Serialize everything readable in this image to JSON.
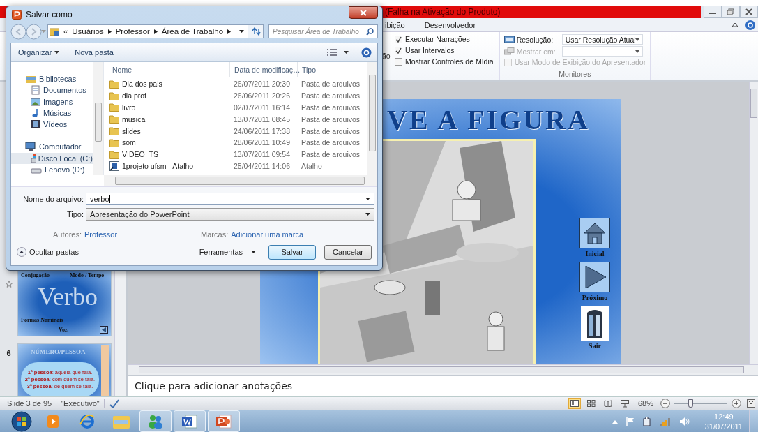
{
  "powerpoint": {
    "title": "(Falha na Ativação do Produto)",
    "tabs": [
      {
        "label": "ibição",
        "selected": false
      },
      {
        "label": "Desenvolvedor",
        "selected": false
      }
    ],
    "ribbon": {
      "cut_label": "ão",
      "options": [
        {
          "label": "Executar Narrações",
          "checked": true,
          "disabled": false
        },
        {
          "label": "Usar Intervalos",
          "checked": true,
          "disabled": false
        },
        {
          "label": "Mostrar Controles de Mídia",
          "checked": false,
          "disabled": false
        }
      ],
      "monitors": {
        "resolution_label": "Resolução:",
        "resolution_value": "Usar Resolução Atual",
        "show_on_label": "Mostrar em:",
        "presenter": {
          "label": "Usar Modo de Exibição do Apresentador",
          "checked": false,
          "disabled": true
        },
        "label": "Monitores"
      }
    },
    "slides": [
      {
        "animated": true,
        "selected": false,
        "kind": "verbo",
        "top_labels": [
          "Conjugação",
          "Modo / Tempo"
        ],
        "title": "Verbo",
        "bottom_labels": [
          "Formas Nominais",
          "Voz"
        ]
      },
      {
        "number": "6",
        "animated": false,
        "selected": false,
        "kind": "pessoa",
        "title": "NÚMERO/PESSOA",
        "lines": [
          "**1ª pessoa**: aquela que fala.",
          "**2ª pessoa**: com quem se fala.",
          "**3ª pessoa**: de quem se fala."
        ]
      }
    ],
    "slide": {
      "title": "VE A FIGURA",
      "nav": [
        {
          "label": "Inicial",
          "kind": "home"
        },
        {
          "label": "Próximo",
          "kind": "next"
        },
        {
          "label": "Sair",
          "kind": "exit"
        }
      ]
    },
    "notes_placeholder": "Clique para adicionar anotações",
    "status": {
      "slide_info": "Slide 3 de 95",
      "theme": "\"Executivo\"",
      "views": [
        {
          "kind": "normal",
          "selected": true
        },
        {
          "kind": "sorter",
          "selected": false
        },
        {
          "kind": "reading",
          "selected": false
        },
        {
          "kind": "slideshow",
          "selected": false
        }
      ],
      "zoom": "68%",
      "zoom_slider": {
        "level": 0.3
      }
    }
  },
  "dialog": {
    "title": "Salvar como",
    "breadcrumb_prefix": "«",
    "breadcrumb": [
      "Usuários",
      "Professor",
      "Área de Trabalho"
    ],
    "search": {
      "placeholder": "Pesquisar Área de Trabalho"
    },
    "toolbar": [
      {
        "label": "Organizar",
        "kind": "menu"
      },
      {
        "label": "Nova pasta",
        "kind": "button"
      }
    ],
    "nav": [
      {
        "label": "Bibliotecas",
        "kind": "library",
        "selected": false,
        "children": [
          {
            "label": "Documentos",
            "kind": "documents",
            "selected": false
          },
          {
            "label": "Imagens",
            "kind": "images",
            "selected": false
          },
          {
            "label": "Músicas",
            "kind": "music",
            "selected": false
          },
          {
            "label": "Vídeos",
            "kind": "videos",
            "selected": false
          }
        ]
      },
      {
        "label": "Computador",
        "kind": "computer",
        "selected": false,
        "children": [
          {
            "label": "Disco Local (C:)",
            "kind": "disk",
            "selected": true
          },
          {
            "label": "Lenovo (D:)",
            "kind": "drive",
            "selected": false
          }
        ]
      }
    ],
    "columns": [
      "Nome",
      "Data de modificaç…",
      "Tipo"
    ],
    "files": [
      {
        "name": "Dia dos pais",
        "date": "26/07/2011 20:30",
        "type": "Pasta de arquivos",
        "kind": "folder"
      },
      {
        "name": "dia prof",
        "date": "26/06/2011 20:26",
        "type": "Pasta de arquivos",
        "kind": "folder"
      },
      {
        "name": "livro",
        "date": "02/07/2011 16:14",
        "type": "Pasta de arquivos",
        "kind": "folder"
      },
      {
        "name": "musica",
        "date": "13/07/2011 08:45",
        "type": "Pasta de arquivos",
        "kind": "folder"
      },
      {
        "name": "slides",
        "date": "24/06/2011 17:38",
        "type": "Pasta de arquivos",
        "kind": "folder"
      },
      {
        "name": "som",
        "date": "28/06/2011 10:49",
        "type": "Pasta de arquivos",
        "kind": "folder"
      },
      {
        "name": "VIDEO_TS",
        "date": "13/07/2011 09:54",
        "type": "Pasta de arquivos",
        "kind": "folder"
      },
      {
        "name": "1projeto ufsm - Atalho",
        "date": "25/04/2011 14:06",
        "type": "Atalho",
        "kind": "shortcut"
      }
    ],
    "filename_label": "Nome do arquivo:",
    "filename": "verbo",
    "type_label": "Tipo:",
    "type_value": "Apresentação do PowerPoint",
    "authors_label": "Autores:",
    "authors": "Professor",
    "tags_label": "Marcas:",
    "tags": "Adicionar uma marca",
    "hide_folders": "Ocultar pastas",
    "tools": "Ferramentas",
    "buttons": [
      {
        "label": "Salvar",
        "default": true
      },
      {
        "label": "Cancelar",
        "default": false
      }
    ]
  },
  "taskbar": {
    "apps": [
      {
        "kind": "media",
        "running": false
      },
      {
        "kind": "ie",
        "running": false
      },
      {
        "kind": "explorer",
        "running": false
      },
      {
        "kind": "messenger",
        "running": true
      },
      {
        "kind": "word",
        "running": true
      },
      {
        "kind": "powerpoint",
        "running": true
      }
    ],
    "time": "12:49",
    "date": "31/07/2011"
  }
}
